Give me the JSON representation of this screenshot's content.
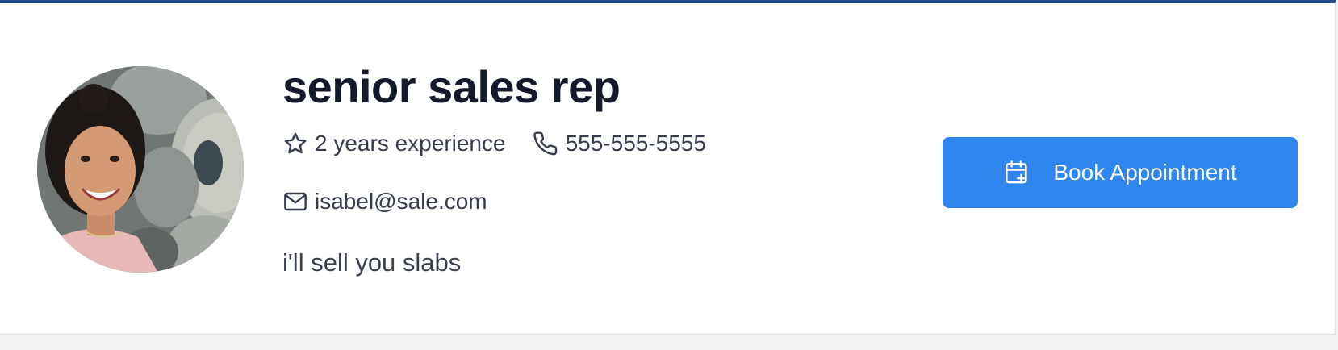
{
  "profile": {
    "title": "senior sales rep",
    "experience": "2 years experience",
    "phone": "555-555-5555",
    "email": "isabel@sale.com",
    "bio": "i'll sell you slabs",
    "avatar_alt": "Profile photo"
  },
  "actions": {
    "book_label": "Book Appointment"
  },
  "icons": {
    "experience": "star-icon",
    "phone": "phone-icon",
    "email": "mail-icon",
    "book": "calendar-plus-icon"
  },
  "colors": {
    "accent": "#2f86ee",
    "top_border": "#1e4e8c",
    "title": "#141a2b",
    "text": "#353c4c"
  }
}
